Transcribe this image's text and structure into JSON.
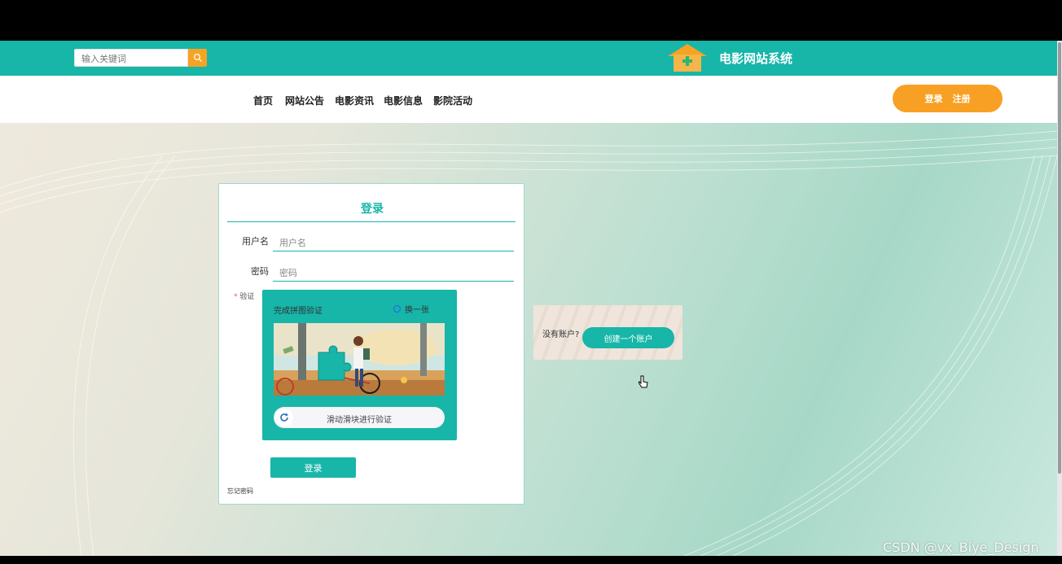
{
  "header": {
    "search_placeholder": "输入关键词",
    "site_title": "电影网站系统"
  },
  "nav": {
    "items": [
      "首页",
      "网站公告",
      "电影资讯",
      "电影信息",
      "影院活动"
    ],
    "login_label": "登录",
    "register_label": "注册"
  },
  "login": {
    "title": "登录",
    "username_label": "用户名",
    "username_placeholder": "用户名",
    "password_label": "密码",
    "password_placeholder": "密码",
    "verify_required_mark": "*",
    "verify_label": "验证",
    "captcha_title": "完成拼图验证",
    "captcha_refresh": "换一张",
    "slider_text": "滑动滑块进行验证",
    "submit_label": "登录",
    "forgot_password": "忘记密码"
  },
  "register": {
    "prompt": "没有账户?",
    "button_label": "创建一个账户"
  },
  "watermark": "CSDN @vx_Biye_Design",
  "colors": {
    "brand": "#17b6a9",
    "accent": "#f8a023"
  }
}
